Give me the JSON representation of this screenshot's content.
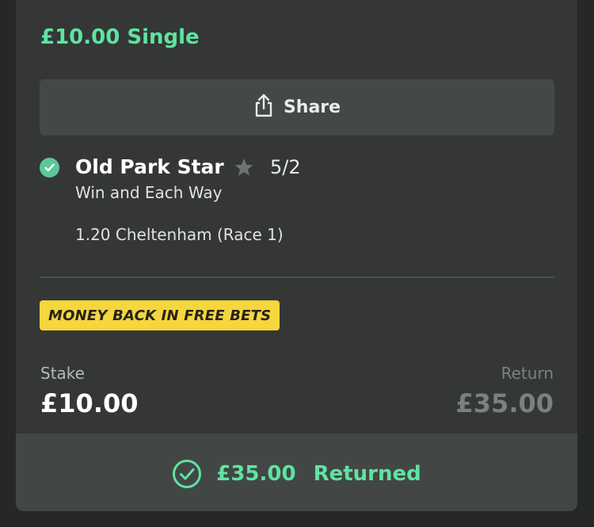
{
  "bet": {
    "title": "£10.00 Single",
    "share_label": "Share",
    "selection": {
      "name": "Old Park Star",
      "odds": "5/2",
      "market": "Win and Each Way",
      "event": "1.20 Cheltenham (Race 1)"
    },
    "promo_badge": "MONEY BACK IN FREE BETS",
    "stake": {
      "label": "Stake",
      "value": "£10.00"
    },
    "return": {
      "label": "Return",
      "value": "£35.00"
    },
    "footer": {
      "amount": "£35.00",
      "status": "Returned"
    }
  },
  "icons": {
    "share": "share-icon",
    "selection_check": "check-circle-icon",
    "favourite": "star-icon",
    "returned": "check-circle-outline-icon"
  },
  "colors": {
    "accent_green": "#5fe3a1",
    "promo_yellow": "#f5d63d",
    "card_bg": "#343736",
    "page_bg": "#262827"
  }
}
